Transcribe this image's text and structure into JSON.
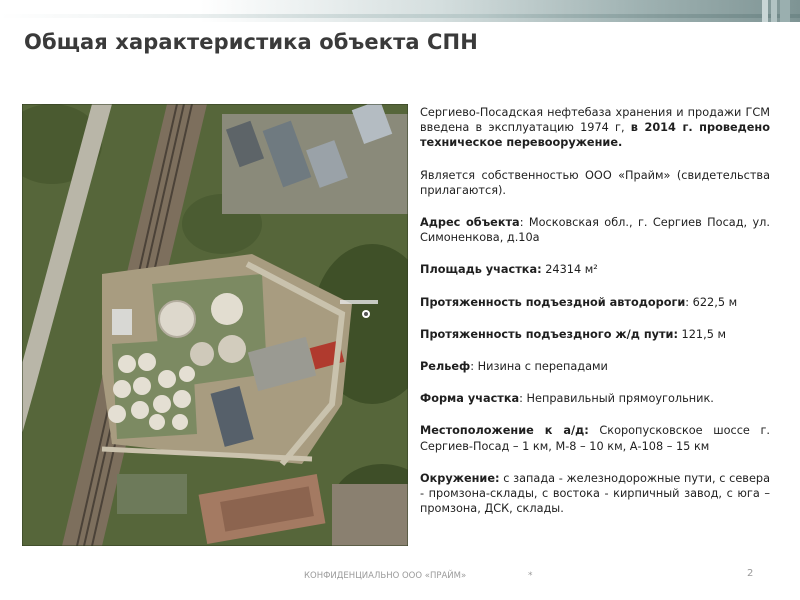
{
  "slide": {
    "title": "Общая характеристика объекта СПН"
  },
  "info": {
    "intro_text": "Сергиево-Посадская нефтебаза хранения и продажи ГСМ введена в эксплуатацию 1974 г, ",
    "intro_bold": "в 2014 г. проведено техническое перевооружение.",
    "owner_text": "Является собственностью ООО «Прайм» (свидетельства прилагаются).",
    "rows": [
      {
        "label": "Адрес объекта",
        "value": ": Московская обл., г. Сергиев Посад, ул. Симоненкова, д.10а"
      },
      {
        "label": "Площадь участка:",
        "value": " 24314 м²"
      },
      {
        "label": "Протяженность подъездной автодороги",
        "value": ": 622,5 м"
      },
      {
        "label": "Протяженность подъездного ж/д пути:",
        "value": " 121,5 м"
      },
      {
        "label": "Рельеф",
        "value": ": Низина с перепадами"
      },
      {
        "label": "Форма участка",
        "value": ": Неправильный прямоугольник."
      },
      {
        "label": "Местоположение к а/д:",
        "value": " Скоропусковское шоссе г. Сергиев-Посад – 1 км, М-8 – 10 км, А-108 – 15 км"
      },
      {
        "label": "Окружение:",
        "value": " с запада - железнодорожные пути, с севера - промзона-склады, с востока - кирпичный завод, с юга – промзона, ДСК, склады."
      }
    ]
  },
  "footer": {
    "confidential": "КОНФИДЕНЦИАЛЬНО ООО «ПРАЙМ»",
    "star": "*",
    "page": "2"
  }
}
